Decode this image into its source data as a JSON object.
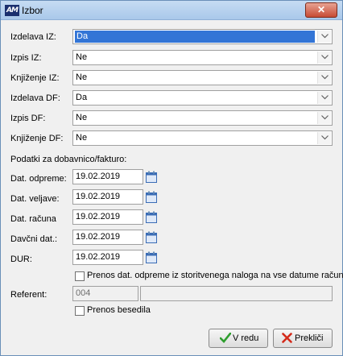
{
  "window": {
    "title": "Izbor",
    "app_icon_text": "AM",
    "close_glyph": "✕"
  },
  "fields": [
    {
      "label": "Izdelava IZ:",
      "value": "Da"
    },
    {
      "label": "Izpis IZ:",
      "value": "Ne"
    },
    {
      "label": "Knjiženje IZ:",
      "value": "Ne"
    },
    {
      "label": "Izdelava DF:",
      "value": "Da"
    },
    {
      "label": "Izpis DF:",
      "value": "Ne"
    },
    {
      "label": "Knjiženje DF:",
      "value": "Ne"
    }
  ],
  "section_label": "Podatki za dobavnico/fakturo:",
  "dates": [
    {
      "label": "Dat. odpreme:",
      "value": "19.02.2019"
    },
    {
      "label": "Dat. veljave:",
      "value": "19.02.2019"
    },
    {
      "label": "Dat. računa",
      "value": "19.02.2019"
    },
    {
      "label": "Davčni dat.:",
      "value": "19.02.2019"
    },
    {
      "label": "DUR:",
      "value": "19.02.2019"
    }
  ],
  "checkbox_prenos_dat": {
    "label": "Prenos dat. odpreme iz storitvenega naloga na vse datume računa",
    "checked": false
  },
  "referent": {
    "label": "Referent:",
    "code": "004",
    "name": ""
  },
  "checkbox_prenos_besedila": {
    "label": "Prenos besedila",
    "checked": false
  },
  "buttons": {
    "ok_label": "V redu",
    "cancel_label": "Prekliči"
  },
  "colors": {
    "selection": "#3375d6",
    "ok_icon": "#2e9e2e",
    "cancel_icon": "#d42a1a"
  }
}
